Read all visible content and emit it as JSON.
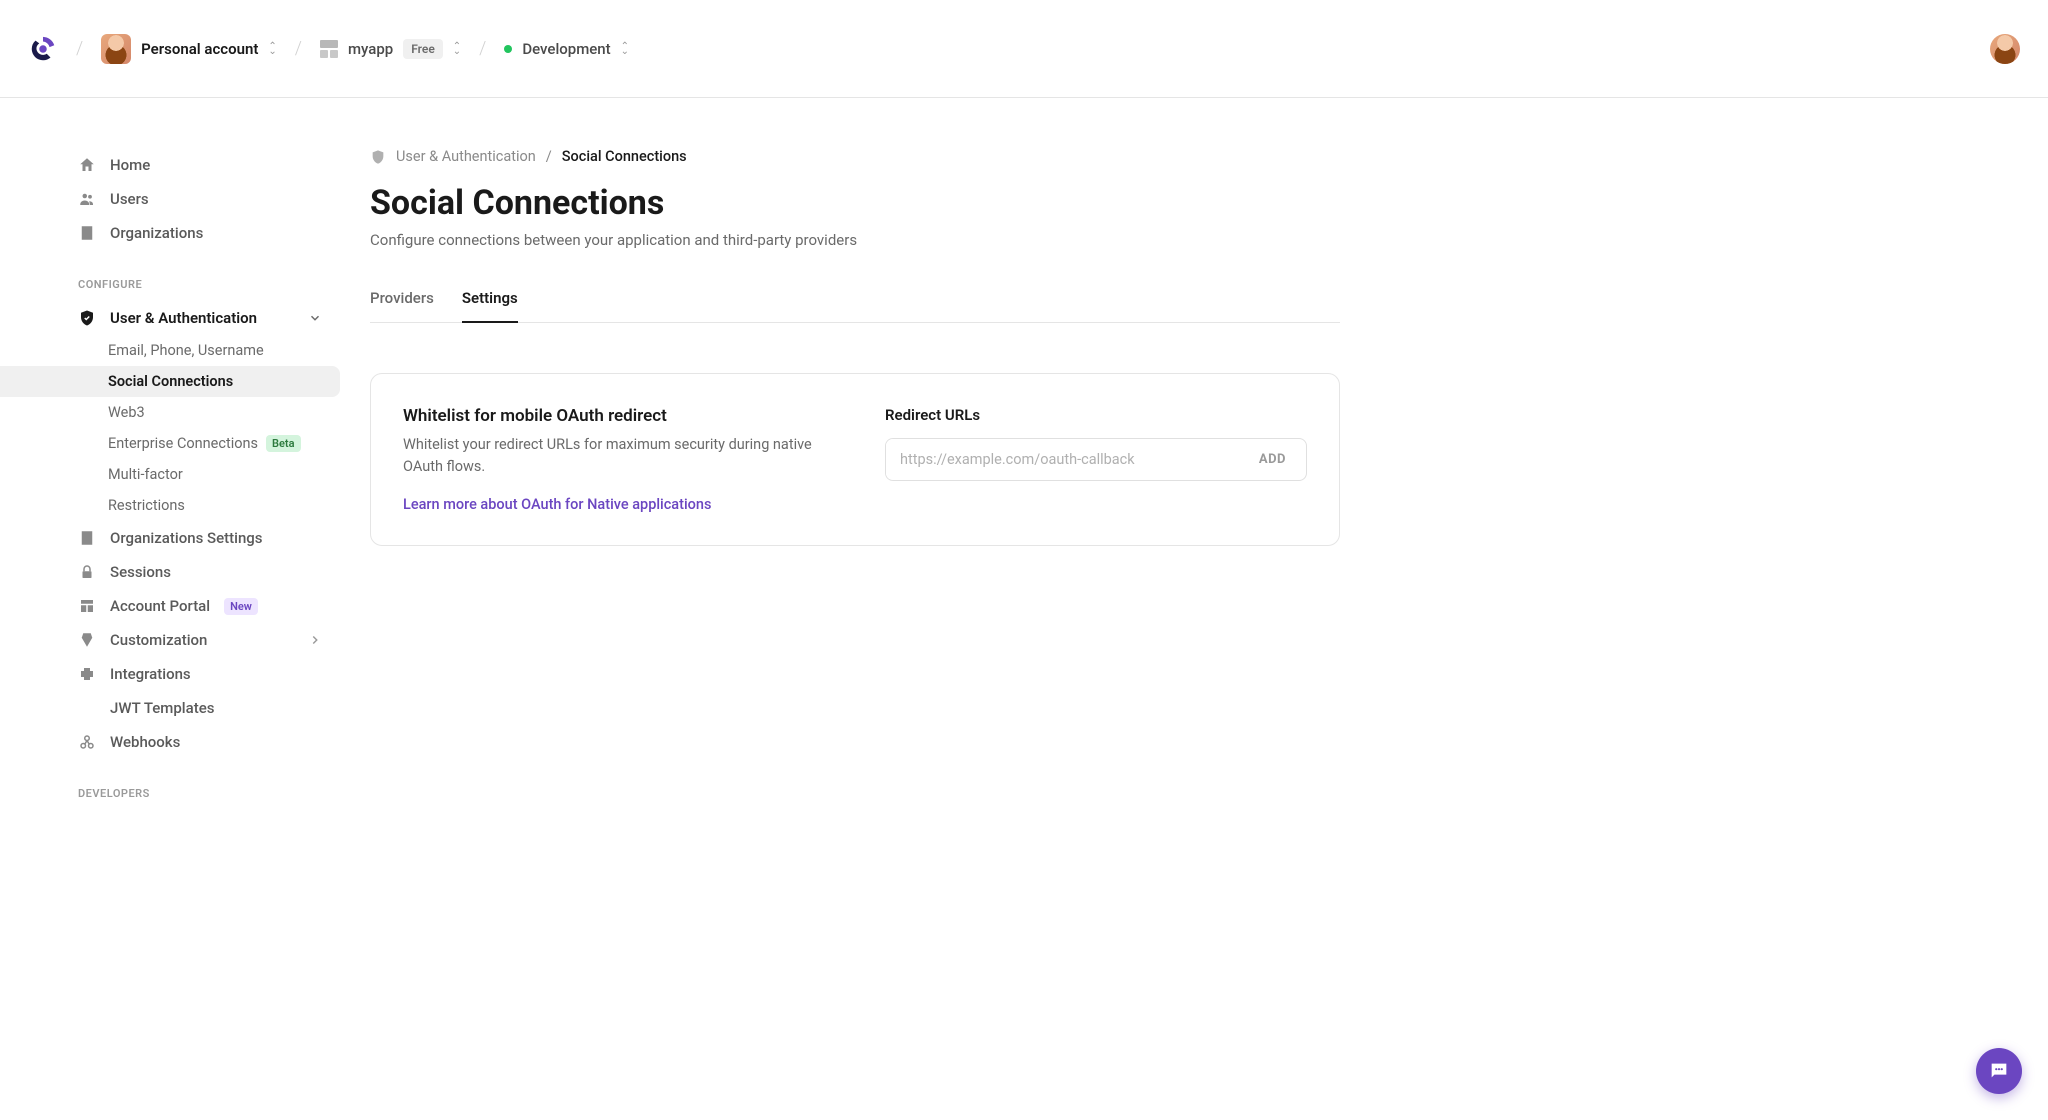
{
  "header": {
    "account_label": "Personal account",
    "app_name": "myapp",
    "app_plan": "Free",
    "env_label": "Development"
  },
  "sidebar": {
    "top": [
      {
        "label": "Home"
      },
      {
        "label": "Users"
      },
      {
        "label": "Organizations"
      }
    ],
    "section_configure": "CONFIGURE",
    "user_auth": {
      "label": "User & Authentication",
      "children": [
        {
          "label": "Email, Phone, Username"
        },
        {
          "label": "Social Connections"
        },
        {
          "label": "Web3"
        },
        {
          "label": "Enterprise Connections",
          "badge": "Beta"
        },
        {
          "label": "Multi-factor"
        },
        {
          "label": "Restrictions"
        }
      ]
    },
    "rest": [
      {
        "label": "Organizations Settings"
      },
      {
        "label": "Sessions"
      },
      {
        "label": "Account Portal",
        "badge": "New"
      },
      {
        "label": "Customization",
        "chevron": true
      },
      {
        "label": "Integrations"
      },
      {
        "label": "JWT Templates"
      },
      {
        "label": "Webhooks"
      }
    ],
    "section_developers": "DEVELOPERS"
  },
  "crumbs": {
    "parent": "User & Authentication",
    "current": "Social Connections"
  },
  "page": {
    "title": "Social Connections",
    "subtitle": "Configure connections between your application and third-party providers"
  },
  "tabs": {
    "providers": "Providers",
    "settings": "Settings"
  },
  "card": {
    "title": "Whitelist for mobile OAuth redirect",
    "desc": "Whitelist your redirect URLs for maximum security during native OAuth flows.",
    "learn": "Learn more about OAuth for Native applications",
    "field_label": "Redirect URLs",
    "placeholder": "https://example.com/oauth-callback",
    "add": "ADD"
  }
}
